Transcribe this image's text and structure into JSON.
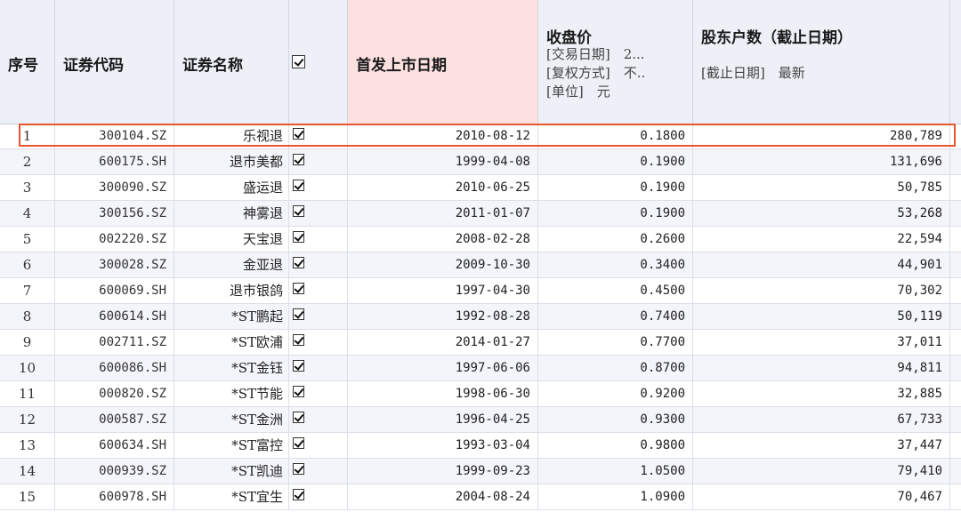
{
  "header": {
    "seq": "序号",
    "code": "证券代码",
    "name": "证券名称",
    "ipo_date": "首发上市日期",
    "close": {
      "title": "收盘价",
      "params": [
        "[交易日期]　2...",
        "[复权方式]　不..",
        "[单位]　元"
      ]
    },
    "holders": {
      "title": "股东户数（截止日期）",
      "params": [
        "[截止日期]　最新"
      ]
    }
  },
  "rows": [
    {
      "seq": "1",
      "code": "300104.SZ",
      "name": "乐视退",
      "date": "2010-08-12",
      "close": "0.1800",
      "holders": "280,789"
    },
    {
      "seq": "2",
      "code": "600175.SH",
      "name": "退市美都",
      "date": "1999-04-08",
      "close": "0.1900",
      "holders": "131,696"
    },
    {
      "seq": "3",
      "code": "300090.SZ",
      "name": "盛运退",
      "date": "2010-06-25",
      "close": "0.1900",
      "holders": "50,785"
    },
    {
      "seq": "4",
      "code": "300156.SZ",
      "name": "神雾退",
      "date": "2011-01-07",
      "close": "0.1900",
      "holders": "53,268"
    },
    {
      "seq": "5",
      "code": "002220.SZ",
      "name": "天宝退",
      "date": "2008-02-28",
      "close": "0.2600",
      "holders": "22,594"
    },
    {
      "seq": "6",
      "code": "300028.SZ",
      "name": "金亚退",
      "date": "2009-10-30",
      "close": "0.3400",
      "holders": "44,901"
    },
    {
      "seq": "7",
      "code": "600069.SH",
      "name": "退市银鸽",
      "date": "1997-04-30",
      "close": "0.4500",
      "holders": "70,302"
    },
    {
      "seq": "8",
      "code": "600614.SH",
      "name": "*ST鹏起",
      "date": "1992-08-28",
      "close": "0.7400",
      "holders": "50,119"
    },
    {
      "seq": "9",
      "code": "002711.SZ",
      "name": "*ST欧浦",
      "date": "2014-01-27",
      "close": "0.7700",
      "holders": "37,011"
    },
    {
      "seq": "10",
      "code": "600086.SH",
      "name": "*ST金钰",
      "date": "1997-06-06",
      "close": "0.8700",
      "holders": "94,811"
    },
    {
      "seq": "11",
      "code": "000820.SZ",
      "name": "*ST节能",
      "date": "1998-06-30",
      "close": "0.9200",
      "holders": "32,885"
    },
    {
      "seq": "12",
      "code": "000587.SZ",
      "name": "*ST金洲",
      "date": "1996-04-25",
      "close": "0.9300",
      "holders": "67,733"
    },
    {
      "seq": "13",
      "code": "600634.SH",
      "name": "*ST富控",
      "date": "1993-03-04",
      "close": "0.9800",
      "holders": "37,447"
    },
    {
      "seq": "14",
      "code": "000939.SZ",
      "name": "*ST凯迪",
      "date": "1999-09-23",
      "close": "1.0500",
      "holders": "79,410"
    },
    {
      "seq": "15",
      "code": "600978.SH",
      "name": "*ST宜生",
      "date": "2004-08-24",
      "close": "1.0900",
      "holders": "70,467"
    }
  ],
  "colors": {
    "highlight_border": "#e8562f",
    "sorted_column_bg": "#fde0e0",
    "header_bg": "#eef0f8"
  },
  "icons": {
    "checkbox": "checkbox-checked-icon"
  }
}
